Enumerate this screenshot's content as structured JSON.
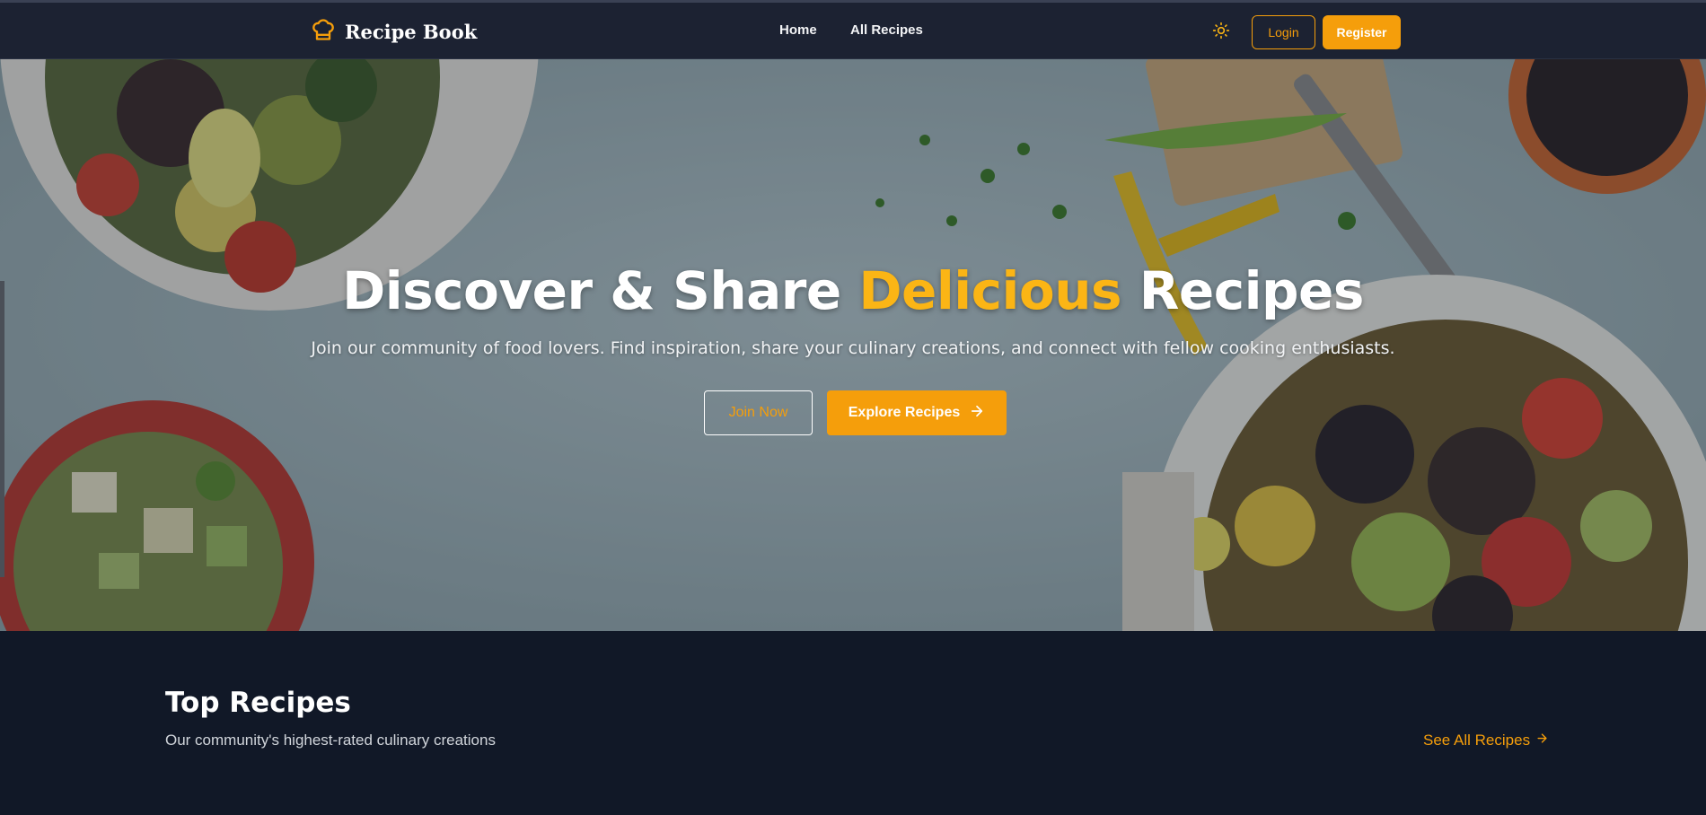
{
  "navbar": {
    "brand": "Recipe Book",
    "links": [
      "Home",
      "All Recipes"
    ],
    "login_label": "Login",
    "register_label": "Register",
    "theme_icon": "sun-icon",
    "brand_icon": "chef-hat-icon"
  },
  "hero": {
    "title_part1": "Discover & Share ",
    "title_accent": "Delicious",
    "title_part2": " Recipes",
    "subtitle": "Join our community of food lovers. Find inspiration, share your culinary creations, and connect with fellow cooking enthusiasts.",
    "join_label": "Join Now",
    "explore_label": "Explore Recipes",
    "explore_icon": "arrow-right-icon"
  },
  "top_recipes": {
    "title": "Top Recipes",
    "subtitle": "Our community's highest-rated culinary creations",
    "see_all_label": "See All Recipes",
    "see_all_icon": "arrow-right-icon"
  },
  "colors": {
    "accent": "#f59e0b",
    "navbar_bg": "#1c2232",
    "page_bg": "#111827"
  }
}
